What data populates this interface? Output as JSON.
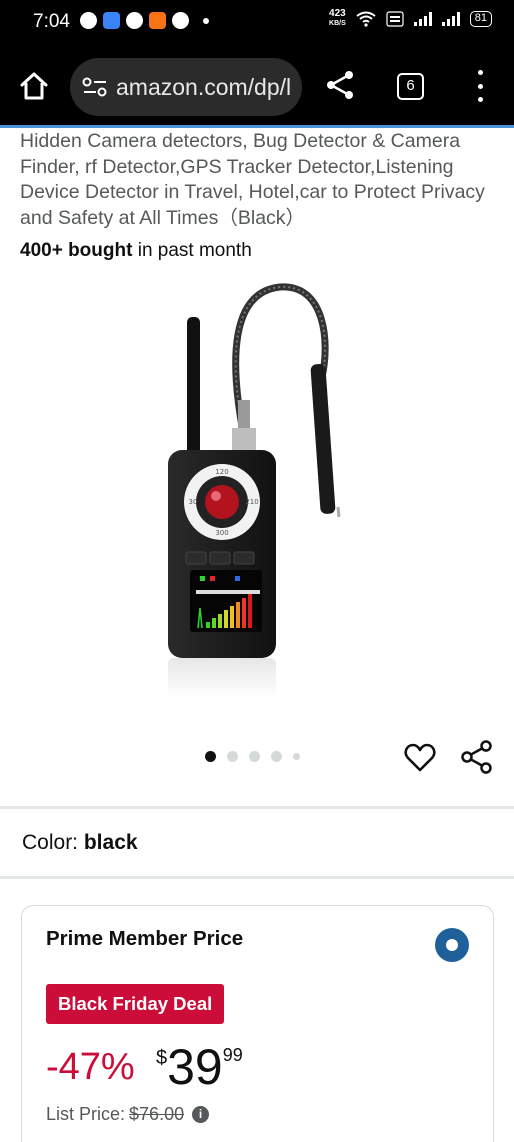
{
  "status_bar": {
    "time": "7:04",
    "speed_value": "423",
    "speed_unit": "KB/S",
    "battery": "81"
  },
  "browser": {
    "url": "amazon.com/dp/l",
    "tab_count": "6"
  },
  "product": {
    "title": "Hidden Camera detectors, Bug Detector & Camera Finder, rf Detector,GPS Tracker Detector,Listening Device Detector in Travel, Hotel,car to Protect Privacy and Safety at All Times（Black）",
    "bought_bold": "400+ bought",
    "bought_rest": " in past month",
    "image_alt": "Hidden camera detector device with antenna and probe",
    "carousel": {
      "total": 5,
      "active": 1
    }
  },
  "color": {
    "label": "Color: ",
    "value": "black"
  },
  "price_card": {
    "label": "Prime Member Price",
    "badge": "Black Friday Deal",
    "discount": "-47%",
    "currency": "$",
    "whole": "39",
    "fraction": "99",
    "list_label": "List Price: ",
    "list_value": "$76.00"
  },
  "colors": {
    "deal_red": "#cc0c39",
    "radio_blue": "#1f5f9a",
    "progress_blue": "#4a90d9"
  }
}
